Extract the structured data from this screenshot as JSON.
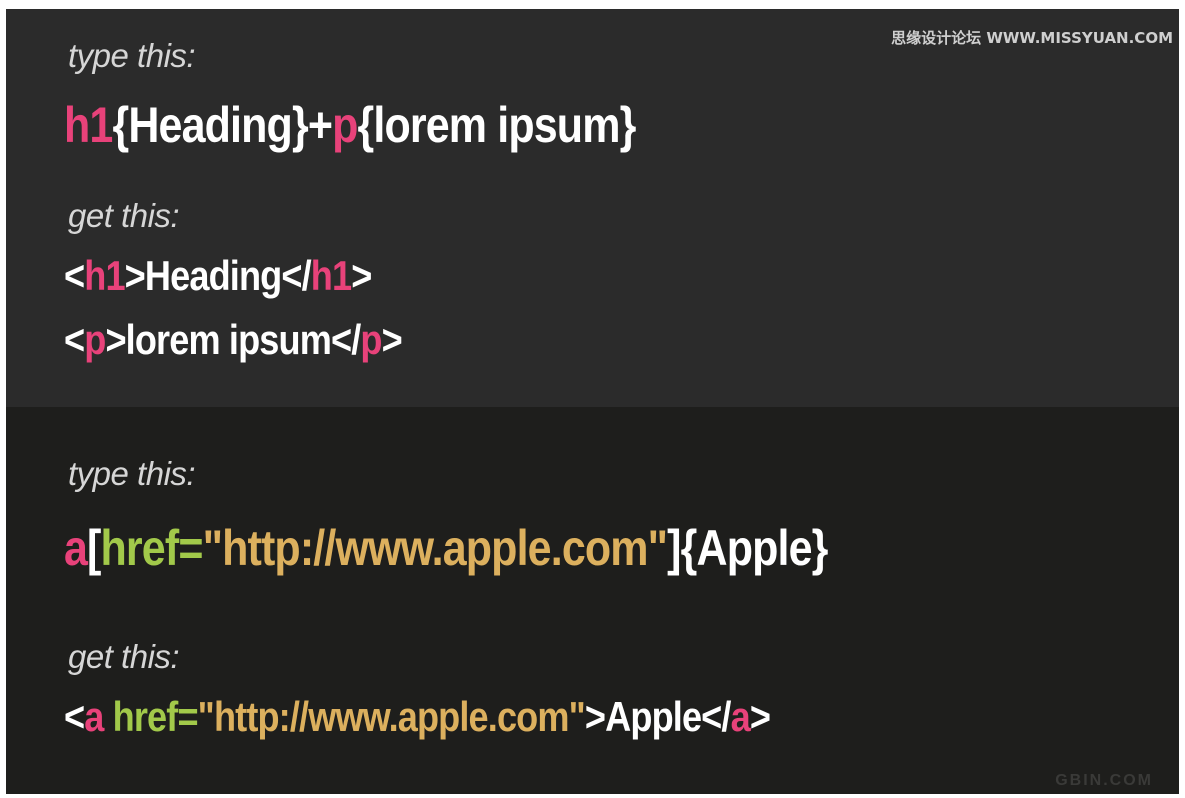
{
  "watermark_top": "思缘设计论坛 WWW.MISSYUAN.COM",
  "watermark_bottom": "GBIN.COM",
  "example1": {
    "type_label": "type this:",
    "input": [
      {
        "t": "h1",
        "c": "tag"
      },
      {
        "t": "{Heading}+",
        "c": "plain"
      },
      {
        "t": "p",
        "c": "tag"
      },
      {
        "t": "{lorem ipsum}",
        "c": "plain"
      }
    ],
    "get_label": "get this:",
    "output_lines": [
      [
        {
          "t": "<",
          "c": "plain"
        },
        {
          "t": "h1",
          "c": "tag"
        },
        {
          "t": ">Heading</",
          "c": "plain"
        },
        {
          "t": "h1",
          "c": "tag"
        },
        {
          "t": ">",
          "c": "plain"
        }
      ],
      [
        {
          "t": "<",
          "c": "plain"
        },
        {
          "t": "p",
          "c": "tag"
        },
        {
          "t": ">lorem ipsum</",
          "c": "plain"
        },
        {
          "t": "p",
          "c": "tag"
        },
        {
          "t": ">",
          "c": "plain"
        }
      ]
    ]
  },
  "example2": {
    "type_label": "type this:",
    "input": [
      {
        "t": "a",
        "c": "tag"
      },
      {
        "t": "[",
        "c": "plain"
      },
      {
        "t": "href=",
        "c": "attr"
      },
      {
        "t": "\"http://www.apple.com\"",
        "c": "str"
      },
      {
        "t": "]{Apple}",
        "c": "plain"
      }
    ],
    "get_label": "get this:",
    "output_lines": [
      [
        {
          "t": "<",
          "c": "plain"
        },
        {
          "t": "a",
          "c": "tag"
        },
        {
          "t": " ",
          "c": "plain"
        },
        {
          "t": "href=",
          "c": "attr"
        },
        {
          "t": "\"http://www.apple.com\"",
          "c": "str"
        },
        {
          "t": ">Apple</",
          "c": "plain"
        },
        {
          "t": "a",
          "c": "tag"
        },
        {
          "t": ">",
          "c": "plain"
        }
      ]
    ]
  },
  "colors": {
    "tag": "#e8427a",
    "attribute": "#a2c94a",
    "string": "#dcb05e",
    "text": "#ffffff",
    "label": "#d6d6d6",
    "panel_top": "#2b2b2b",
    "panel_bottom": "#1e1e1c"
  }
}
